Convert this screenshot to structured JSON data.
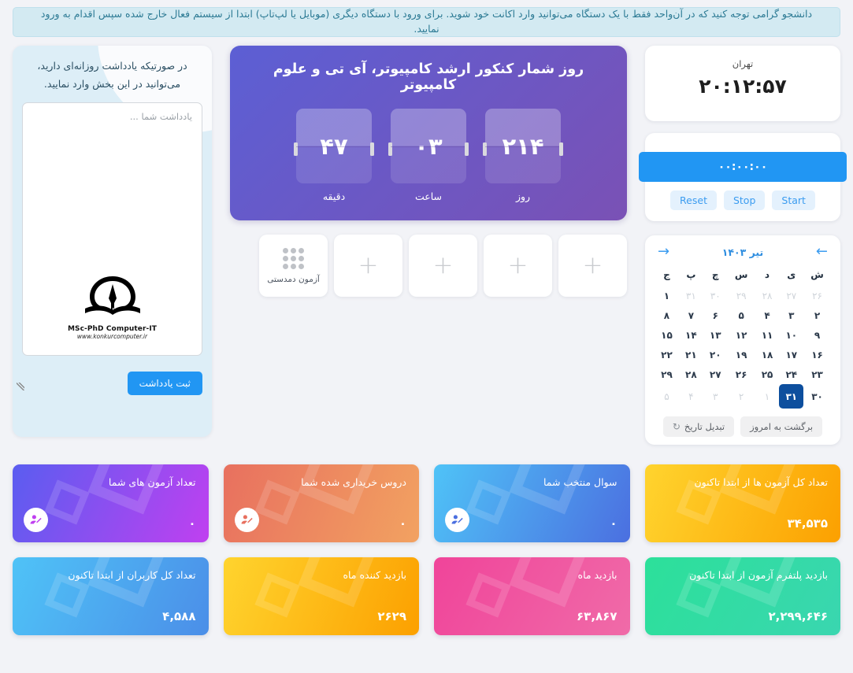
{
  "notice": {
    "text": "دانشجو گرامی توجه کنید که در آن‌واحد فقط با یک دستگاه می‌توانید وارد اکانت خود شوید. برای ورود با دستگاه دیگری (موبایل یا لپ‌تاپ) ابتدا از سیستم فعال خارج شده سپس اقدام به ورود نمایید."
  },
  "clock": {
    "city": "تهران",
    "time": "۲۰:۱۲:۵۷"
  },
  "stopwatch": {
    "display": "۰۰:۰۰:۰۰",
    "reset_label": "Reset",
    "stop_label": "Stop",
    "start_label": "Start"
  },
  "calendar": {
    "title": "تیر ۱۴۰۳",
    "prev_icon": "arrow-left-icon",
    "next_icon": "arrow-right-icon",
    "weekdays": [
      "ش",
      "ی",
      "د",
      "س",
      "چ",
      "پ",
      "ج"
    ],
    "weeks": [
      [
        {
          "d": "۲۶",
          "muted": true
        },
        {
          "d": "۲۷",
          "muted": true
        },
        {
          "d": "۲۸",
          "muted": true
        },
        {
          "d": "۲۹",
          "muted": true
        },
        {
          "d": "۳۰",
          "muted": true
        },
        {
          "d": "۳۱",
          "muted": true
        },
        {
          "d": "۱",
          "muted": false
        }
      ],
      [
        {
          "d": "۲"
        },
        {
          "d": "۳"
        },
        {
          "d": "۴"
        },
        {
          "d": "۵"
        },
        {
          "d": "۶"
        },
        {
          "d": "۷"
        },
        {
          "d": "۸"
        }
      ],
      [
        {
          "d": "۹"
        },
        {
          "d": "۱۰"
        },
        {
          "d": "۱۱"
        },
        {
          "d": "۱۲"
        },
        {
          "d": "۱۳"
        },
        {
          "d": "۱۴"
        },
        {
          "d": "۱۵"
        }
      ],
      [
        {
          "d": "۱۶"
        },
        {
          "d": "۱۷"
        },
        {
          "d": "۱۸"
        },
        {
          "d": "۱۹"
        },
        {
          "d": "۲۰"
        },
        {
          "d": "۲۱"
        },
        {
          "d": "۲۲"
        }
      ],
      [
        {
          "d": "۲۳"
        },
        {
          "d": "۲۴"
        },
        {
          "d": "۲۵"
        },
        {
          "d": "۲۶"
        },
        {
          "d": "۲۷"
        },
        {
          "d": "۲۸"
        },
        {
          "d": "۲۹"
        }
      ],
      [
        {
          "d": "۳۰"
        },
        {
          "d": "۳۱",
          "selected": true
        },
        {
          "d": "۱",
          "muted": true
        },
        {
          "d": "۲",
          "muted": true
        },
        {
          "d": "۳",
          "muted": true
        },
        {
          "d": "۴",
          "muted": true
        },
        {
          "d": "۵",
          "muted": true
        }
      ]
    ],
    "today_label": "برگشت به امروز",
    "convert_label": "تبدیل تاریخ",
    "convert_icon": "refresh-icon"
  },
  "countdown": {
    "title": "روز شمار کنکور ارشد کامپیوتر، آی تی و علوم کامپیوتر",
    "units": [
      {
        "value": "۲۱۴",
        "label": "روز"
      },
      {
        "value": "۰۳",
        "label": "ساعت"
      },
      {
        "value": "۴۷",
        "label": "دقیقه"
      }
    ]
  },
  "tiles": [
    {
      "icon": "plus-icon",
      "label": ""
    },
    {
      "icon": "plus-icon",
      "label": ""
    },
    {
      "icon": "plus-icon",
      "label": ""
    },
    {
      "icon": "plus-icon",
      "label": ""
    },
    {
      "icon": "grid-dots-icon",
      "label": "آزمون دمدستی"
    }
  ],
  "notes": {
    "title": "در صورتیکه یادداشت روزانه‌ای دارید، می‌توانید در این بخش وارد نمایید.",
    "placeholder": "یادداشت شما ...",
    "value": "",
    "submit_label": "ثبت یادداشت",
    "logo_line1": "MSc-PhD Computer-IT",
    "logo_line2": "www.konkurcomputer.ir"
  },
  "stats": [
    {
      "title": "تعداد کل آزمون ها از ابتدا تاکنون",
      "value": "۳۴,۵۳۵",
      "color": "#fca000",
      "theme": "g-yellow",
      "icon": null
    },
    {
      "title": "سوال منتخب شما",
      "value": "۰",
      "color": "#4b6fe0",
      "theme": "g-blue",
      "icon": "user-edit-icon"
    },
    {
      "title": "دروس خریداری شده شما",
      "value": "۰",
      "color": "#e8705f",
      "theme": "g-orange",
      "icon": "user-edit-icon"
    },
    {
      "title": "تعداد آزمون های شما",
      "value": "۰",
      "color": "#c040f0",
      "theme": "g-purple",
      "icon": "user-edit-icon"
    },
    {
      "title": "بازدید پلتفرم آزمون از ابتدا تاکنون",
      "value": "۲,۲۹۹,۶۴۶",
      "color": "#2ce09a",
      "theme": "g-green",
      "icon": null
    },
    {
      "title": "بازدید ماه",
      "value": "۶۳,۸۶۷",
      "color": "#f0449a",
      "theme": "g-pink",
      "icon": null
    },
    {
      "title": "بازدید کننده ماه",
      "value": "۲۶۲۹",
      "color": "#fca000",
      "theme": "g-yellow2",
      "icon": null
    },
    {
      "title": "تعداد کل کاربران از ابتدا تاکنون",
      "value": "۴,۵۸۸",
      "color": "#4b8ee8",
      "theme": "g-blue2",
      "icon": null
    }
  ]
}
